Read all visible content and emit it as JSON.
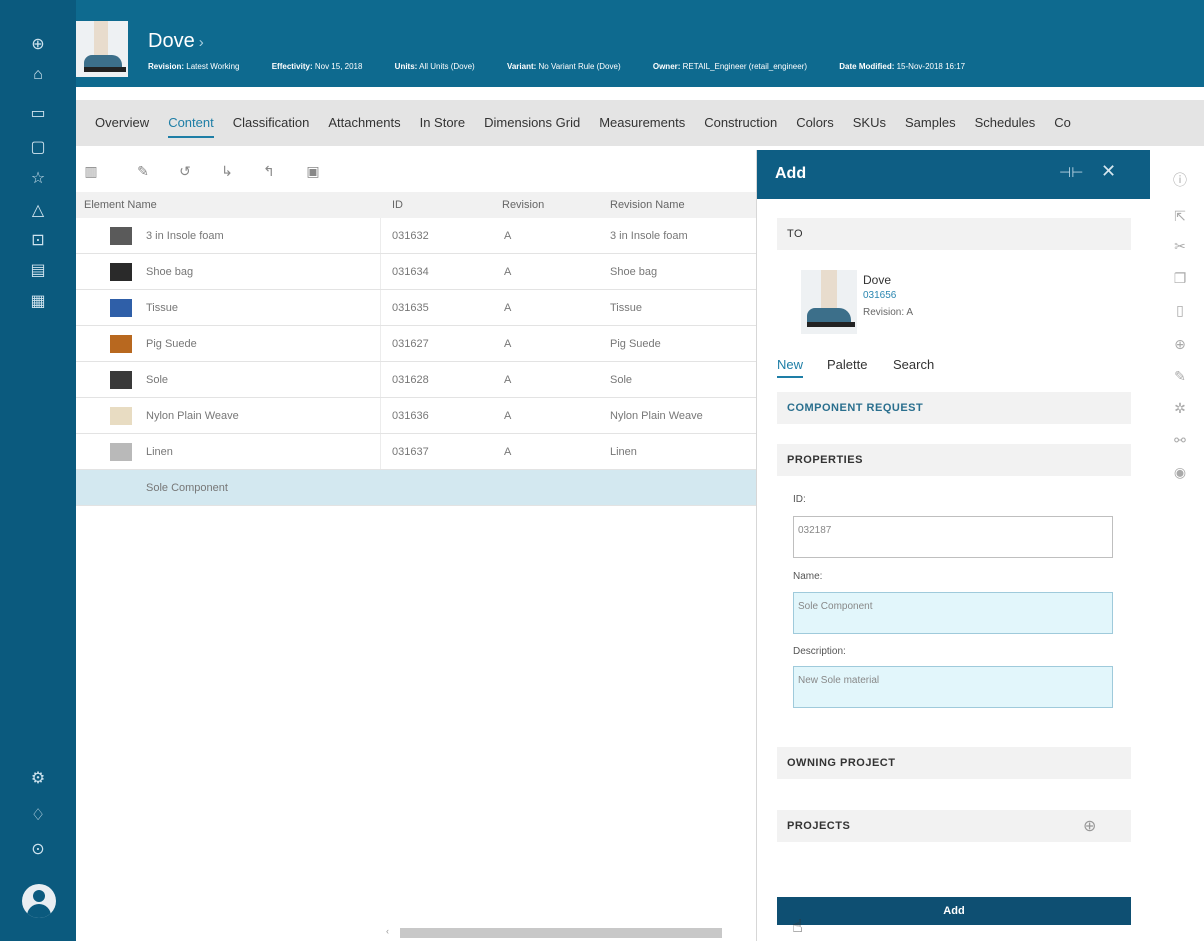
{
  "rail": {
    "icons": [
      "globe-icon",
      "home-icon",
      "folder-icon",
      "inbox-icon",
      "star-icon",
      "alert-icon",
      "import-icon",
      "calendar-icon",
      "report-icon"
    ],
    "bottom_icons": [
      "settings-icon",
      "bell-icon",
      "help-icon"
    ]
  },
  "header": {
    "title": "Dove",
    "meta": [
      {
        "key": "Revision:",
        "value": "Latest Working"
      },
      {
        "key": "Effectivity:",
        "value": "Nov 15, 2018"
      },
      {
        "key": "Units:",
        "value": "All Units (Dove)"
      },
      {
        "key": "Variant:",
        "value": "No Variant Rule (Dove)"
      },
      {
        "key": "Owner:",
        "value": "RETAIL_Engineer (retail_engineer)"
      },
      {
        "key": "Date Modified:",
        "value": "15-Nov-2018 16:17"
      }
    ]
  },
  "tabs": [
    "Overview",
    "Content",
    "Classification",
    "Attachments",
    "In Store",
    "Dimensions Grid",
    "Measurements",
    "Construction",
    "Colors",
    "SKUs",
    "Samples",
    "Schedules",
    "Co"
  ],
  "active_tab": "Content",
  "table": {
    "columns": [
      "Element Name",
      "ID",
      "Revision",
      "Revision Name"
    ],
    "rows": [
      {
        "name": "3 in Insole foam",
        "id": "031632",
        "rev": "A",
        "rev_name": "3 in Insole foam",
        "swatch": "#5a5a5a"
      },
      {
        "name": "Shoe bag",
        "id": "031634",
        "rev": "A",
        "rev_name": "Shoe bag",
        "swatch": "#2a2a2a"
      },
      {
        "name": "Tissue",
        "id": "031635",
        "rev": "A",
        "rev_name": "Tissue",
        "swatch": "#2f5fa8"
      },
      {
        "name": "Pig Suede",
        "id": "031627",
        "rev": "A",
        "rev_name": "Pig Suede",
        "swatch": "#b8681f"
      },
      {
        "name": "Sole",
        "id": "031628",
        "rev": "A",
        "rev_name": "Sole",
        "swatch": "#3a3a3a"
      },
      {
        "name": "Nylon Plain Weave",
        "id": "031636",
        "rev": "A",
        "rev_name": "Nylon Plain Weave",
        "swatch": "#e8dcc2"
      },
      {
        "name": "Linen",
        "id": "031637",
        "rev": "A",
        "rev_name": "Linen",
        "swatch": "#b9b9b9"
      }
    ],
    "new_row": "Sole Component"
  },
  "panel": {
    "title": "Add",
    "to_label": "TO",
    "to_item": {
      "name": "Dove",
      "id": "031656",
      "revision": "Revision:  A"
    },
    "subtabs": [
      "New",
      "Palette",
      "Search"
    ],
    "component_request": "COMPONENT REQUEST",
    "properties": "PROPERTIES",
    "id_label": "ID:",
    "id_value": "032187",
    "name_label": "Name:",
    "name_value": "Sole Component",
    "desc_label": "Description:",
    "desc_value": "New Sole material",
    "owning_project": "OWNING PROJECT",
    "projects": "PROJECTS",
    "add_button": "Add"
  },
  "colors": {
    "rail": "#0b5a7e",
    "header": "#0e6a8f",
    "accent": "#1e7ea6",
    "panel_head": "#0e5e84"
  }
}
